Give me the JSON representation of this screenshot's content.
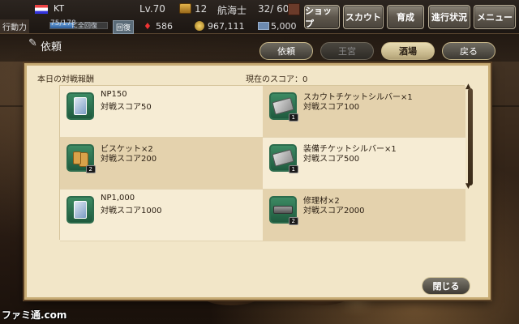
{
  "status": {
    "player_name": "KT",
    "level": "Lv.70",
    "chest_count": "12",
    "role": "航海士",
    "crew": "32/ 60",
    "stamina_label": "行動力",
    "stamina": "75/178",
    "stamina_fill_fraction": 0.42,
    "full_recover_text": "に全回復",
    "recover_button": "回復",
    "rubies": "586",
    "coins": "967,111",
    "cash": "5,000"
  },
  "nav": {
    "shop": "ショップ",
    "scout": "スカウト",
    "train": "育成",
    "progress": "進行状況",
    "menu": "メニュー"
  },
  "subheader": {
    "title": "依頼",
    "tabs": {
      "request": "依頼",
      "royal": "王宮",
      "tavern": "酒場",
      "back": "戻る"
    }
  },
  "panel": {
    "heading": "本日の対戦報酬",
    "current_score": "現在のスコア：0",
    "items": [
      {
        "name": "NP150",
        "score": "対戦スコア50",
        "badge": ""
      },
      {
        "name": "スカウトチケットシルバー×1",
        "score": "対戦スコア100",
        "badge": "1"
      },
      {
        "name": "ビスケット×2",
        "score": "対戦スコア200",
        "badge": "2"
      },
      {
        "name": "装備チケットシルバー×1",
        "score": "対戦スコア500",
        "badge": "1"
      },
      {
        "name": "NP1,000",
        "score": "対戦スコア1000",
        "badge": ""
      },
      {
        "name": "修理材×2",
        "score": "対戦スコア2000",
        "badge": "2"
      }
    ],
    "icons": [
      "np-card-icon",
      "scout-ticket-icon",
      "biscuit-icon",
      "equip-ticket-icon",
      "np-card-icon",
      "repair-material-icon"
    ],
    "close_button": "閉じる"
  },
  "watermark": "ファミ通.com"
}
